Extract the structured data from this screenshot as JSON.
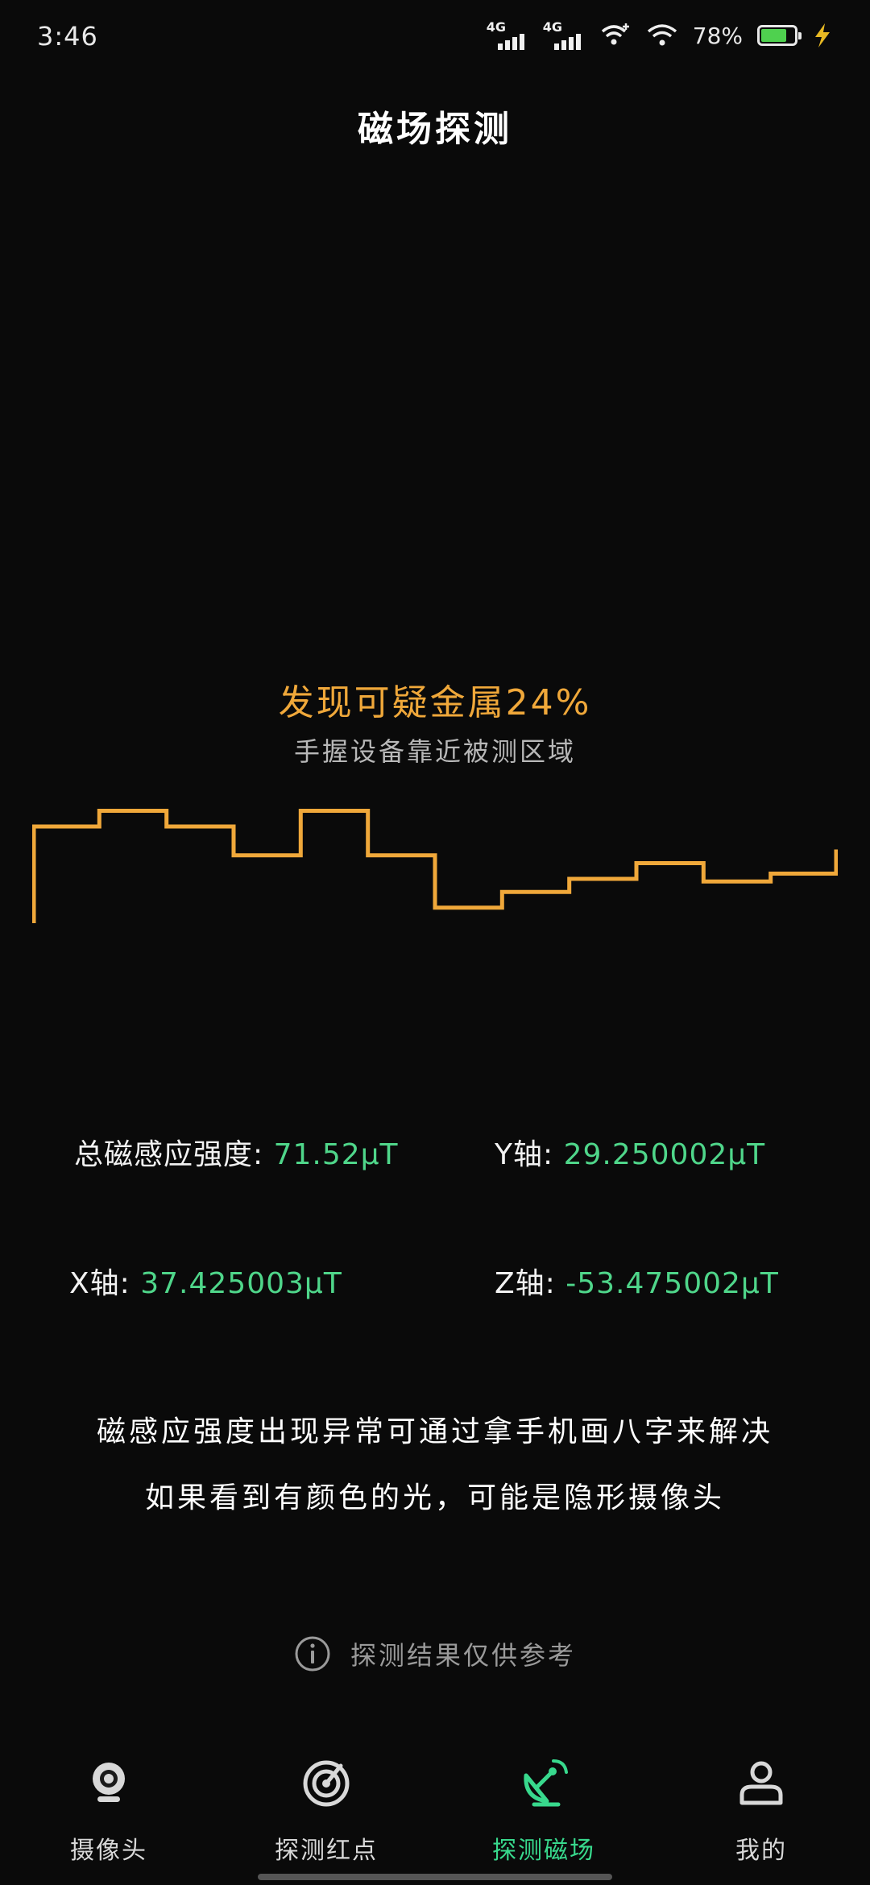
{
  "status_bar": {
    "time": "3:46",
    "network_1": "4G",
    "network_2": "4G",
    "battery_text": "78%",
    "battery_level": 0.78,
    "battery_color": "#4fd14f",
    "icons": [
      "signal-icon",
      "signal-icon",
      "wifi-calling-icon",
      "wifi-icon",
      "battery-icon",
      "charging-icon"
    ]
  },
  "header": {
    "title": "磁场探测"
  },
  "detection": {
    "headline": "发现可疑金属24%",
    "hint": "手握设备靠近被测区域",
    "wave_color": "#f0a83a",
    "wave_levels": [
      0.4,
      0.1,
      0.4,
      0.95,
      0.1,
      0.95,
      1.95,
      1.65,
      1.4,
      1.1,
      1.45,
      1.3
    ]
  },
  "readings": {
    "total_label": "总磁感应强度:",
    "total_value": "71.52μT",
    "y_label": "Y轴:",
    "y_value": "29.250002μT",
    "x_label": "X轴:",
    "x_value": "37.425003μT",
    "z_label": "Z轴:",
    "z_value": "-53.475002μT",
    "value_color": "#4fd68a"
  },
  "info": {
    "line1": "磁感应强度出现异常可通过拿手机画八字来解决",
    "line2": "如果看到有颜色的光，可能是隐形摄像头",
    "disclaimer": "探测结果仅供参考",
    "disclaimer_icon": "info-icon"
  },
  "nav": {
    "items": [
      {
        "label": "摄像头",
        "icon": "camera-icon"
      },
      {
        "label": "探测红点",
        "icon": "radar-icon"
      },
      {
        "label": "探测磁场",
        "icon": "magnet-satellite-icon"
      },
      {
        "label": "我的",
        "icon": "person-icon"
      }
    ],
    "active_index": 2,
    "active_color": "#38d98d"
  }
}
